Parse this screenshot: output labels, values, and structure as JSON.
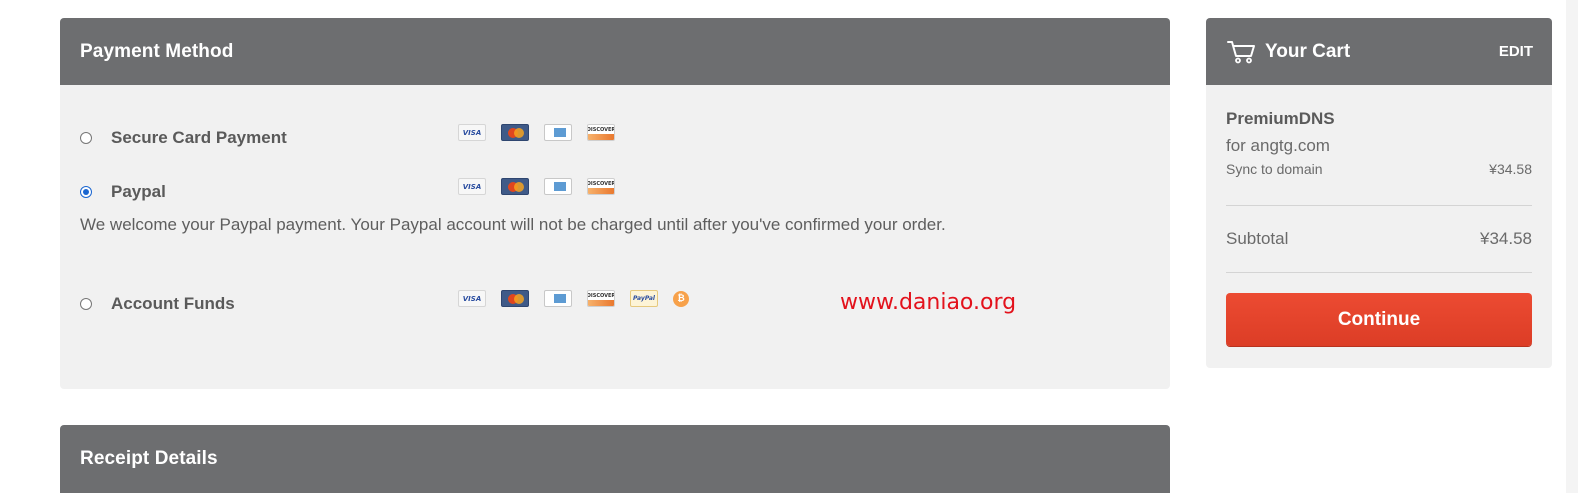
{
  "payment": {
    "title": "Payment Method",
    "options": [
      {
        "label": "Secure Card Payment",
        "selected": false
      },
      {
        "label": "Paypal",
        "selected": true
      },
      {
        "label": "Account Funds",
        "selected": false
      }
    ],
    "paypal_description": "We welcome your Paypal payment. Your Paypal account will not be charged until after you've confirmed your order.",
    "card_icons": [
      "visa-icon",
      "mastercard-icon",
      "amex-icon",
      "discover-icon"
    ],
    "funds_icons": [
      "visa-icon",
      "mastercard-icon",
      "amex-icon",
      "discover-icon",
      "paypal-icon",
      "bitcoin-icon"
    ],
    "card_text": {
      "visa": "VISA",
      "discover": "DISCOVER",
      "paypal": "PayPal",
      "bitcoin": "₿"
    }
  },
  "watermark": "www.daniao.org",
  "receipt": {
    "title": "Receipt Details"
  },
  "cart": {
    "title": "Your Cart",
    "edit_label": "EDIT",
    "product_name": "PremiumDNS",
    "product_domain": "for angtg.com",
    "line_label": "Sync to domain",
    "line_price": "¥34.58",
    "subtotal_label": "Subtotal",
    "subtotal_value": "¥34.58",
    "continue_label": "Continue"
  },
  "colors": {
    "header_bg": "#6d6e70",
    "panel_bg": "#f1f1f1",
    "accent_button": "#e4452d",
    "radio_selected": "#1b66d0",
    "watermark": "#e3121c"
  }
}
